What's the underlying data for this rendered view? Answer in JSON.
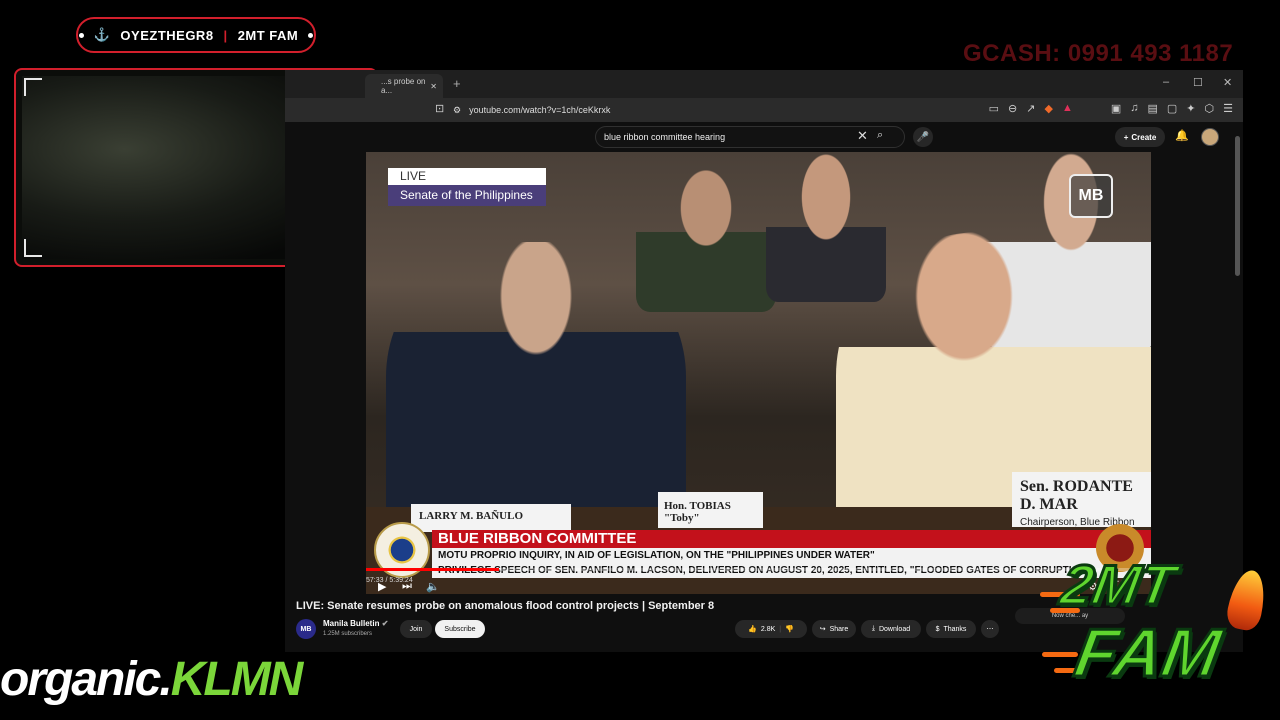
{
  "overlay": {
    "streamer_name": "OYEZTHEGR8",
    "separator": "|",
    "team_name": "2MT FAM",
    "gcash_text": "GCASH: 0991 493 1187",
    "anchor_icon": "anchor-icon",
    "brand_white": "organic.",
    "brand_green": "KLMN",
    "fam_line1": "2MT",
    "fam_line2": "FAM",
    "accent_color": "#d21f2c",
    "brand_green_color": "#7bd63a"
  },
  "browser": {
    "tab_title": "...s probe on a...",
    "new_tab": "+",
    "url": "youtube.com/watch?v=1ch/ceKkrxk",
    "window_controls": [
      "–",
      "☐",
      "✕"
    ]
  },
  "youtube": {
    "search_query": "blue ribbon committee hearing",
    "create_label": "Create",
    "video": {
      "live_label": "LIVE",
      "source_label": "Senate of the Philippines",
      "watermark": "MB",
      "nameplate_left": "LARRY M. BAÑULO",
      "nameplate_mid": "Hon. TOBIAS \"Toby\"",
      "nameplate_right": "Sen. RODANTE D. MAR",
      "nameplate_right_sub": "Chairperson, Blue Ribbon C",
      "lower_third_title": "BLUE RIBBON COMMITTEE",
      "lower_third_line1": "MOTU PROPRIO INQUIRY, IN AID OF LEGISLATION, ON THE \"PHILIPPINES UNDER WATER\"",
      "lower_third_line2": "PRIVILEGE SPEECH OF SEN. PANFILO M. LACSON, DELIVERED ON AUGUST 20, 2025, ENTITLED, \"FLOODED GATES OF CORRUPTION\"",
      "time_display": "57:33 / 5:39:24",
      "progress_fraction": 0.17
    },
    "title": "LIVE: Senate resumes probe on anomalous flood control projects | September 8",
    "channel": {
      "avatar_text": "MB",
      "name": "Manila Bulletin",
      "subscribers": "1.25M subscribers",
      "join_label": "Join",
      "subscribe_label": "Subscribe"
    },
    "actions": {
      "likes": "2.8K",
      "share": "Share",
      "download": "Download",
      "thanks": "Thanks",
      "more": "⋯"
    },
    "side_pill": "Now che... ay"
  }
}
